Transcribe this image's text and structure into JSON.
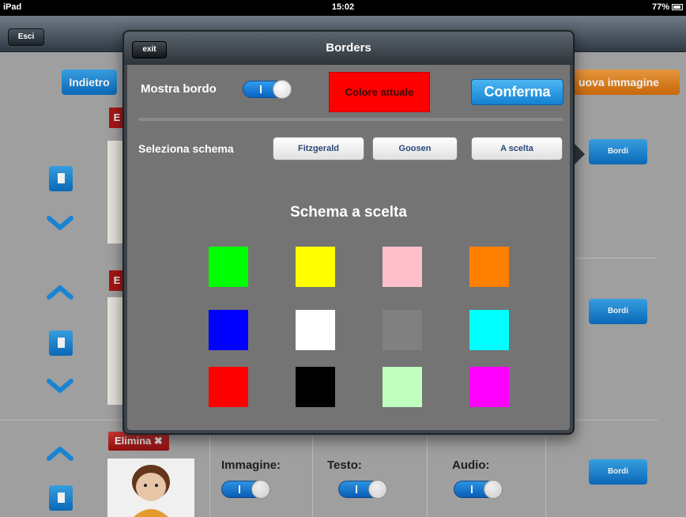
{
  "statusbar": {
    "device": "iPad",
    "time": "15:02",
    "battery": "77%"
  },
  "navbar": {
    "exit_label": "Esci"
  },
  "background": {
    "back_label": "Indietro",
    "new_image_label": "uova immagine",
    "borders_label": "Bordi",
    "delete_label": "Elimina",
    "delete_short": "E",
    "image_label": "Immagine:",
    "text_label": "Testo:",
    "audio_label": "Audio:"
  },
  "popover": {
    "title": "Borders",
    "exit_label": "exit",
    "show_border_label": "Mostra bordo",
    "current_color_label": "Colore attuale",
    "current_color": "#ff0000",
    "confirm_label": "Conferma",
    "select_scheme_label": "Seleziona schema",
    "schemes": [
      "Fitzgerald",
      "Goosen",
      "A scelta"
    ],
    "schema_title": "Schema a scelta",
    "palette": [
      "#00ff00",
      "#ffff00",
      "#ffc0cb",
      "#ff8000",
      "#0000ff",
      "#ffffff",
      "#808080",
      "#00ffff",
      "#ff0000",
      "#000000",
      "#c0ffc0",
      "#ff00ff"
    ]
  }
}
